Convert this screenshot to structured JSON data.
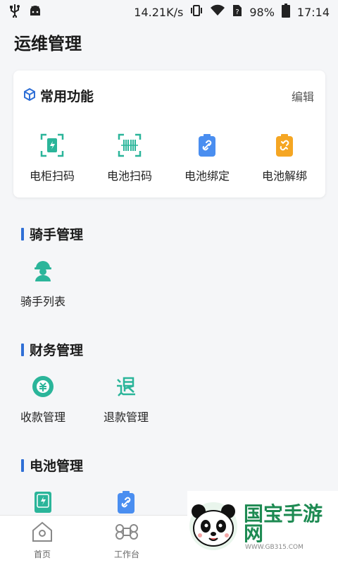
{
  "statusbar": {
    "speed": "14.21K/s",
    "battery": "98%",
    "time": "17:14"
  },
  "page": {
    "title": "运维管理"
  },
  "common": {
    "title": "常用功能",
    "edit": "编辑",
    "items": [
      {
        "label": "电柜扫码",
        "icon": "cabinet-scan-icon"
      },
      {
        "label": "电池扫码",
        "icon": "barcode-scan-icon"
      },
      {
        "label": "电池绑定",
        "icon": "battery-bind-icon"
      },
      {
        "label": "电池解绑",
        "icon": "battery-unbind-icon"
      }
    ]
  },
  "sections": {
    "rider": {
      "title": "骑手管理",
      "items": [
        {
          "label": "骑手列表"
        }
      ]
    },
    "finance": {
      "title": "财务管理",
      "items": [
        {
          "label": "收款管理"
        },
        {
          "label": "退款管理"
        }
      ]
    },
    "battery": {
      "title": "电池管理"
    }
  },
  "tabbar": {
    "tabs": [
      {
        "label": "首页"
      },
      {
        "label": "工作台"
      }
    ]
  },
  "watermark": {
    "text": "国宝手游网",
    "url": "WWW.GB315.COM"
  },
  "colors": {
    "accent": "#2f6fd6",
    "teal": "#2bb59a",
    "orange": "#f5a623",
    "blue": "#4a8ef0"
  }
}
